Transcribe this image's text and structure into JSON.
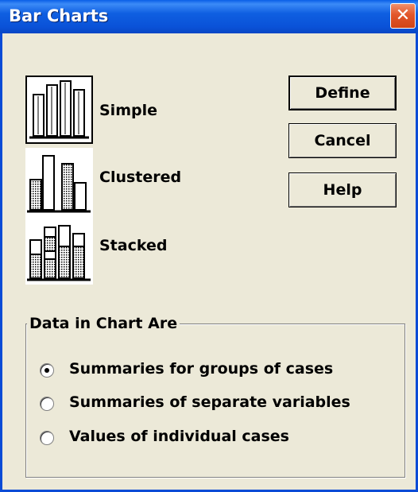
{
  "window": {
    "title": "Bar Charts",
    "close_glyph": "✕"
  },
  "chart_types": [
    {
      "label": "Simple",
      "icon": "simple-bar-chart-icon",
      "selected": true
    },
    {
      "label": "Clustered",
      "icon": "clustered-bar-chart-icon",
      "selected": false
    },
    {
      "label": "Stacked",
      "icon": "stacked-bar-chart-icon",
      "selected": false
    }
  ],
  "buttons": {
    "define": "Define",
    "cancel": "Cancel",
    "help": "Help"
  },
  "data_group": {
    "legend": "Data in Chart Are",
    "options": [
      {
        "label": "Summaries for groups of cases",
        "checked": true
      },
      {
        "label": "Summaries of separate variables",
        "checked": false
      },
      {
        "label": "Values of individual cases",
        "checked": false
      }
    ]
  },
  "colors": {
    "title_bar": "#0a52d8",
    "dialog_bg": "#ece9d8",
    "close_button": "#e2562b"
  }
}
